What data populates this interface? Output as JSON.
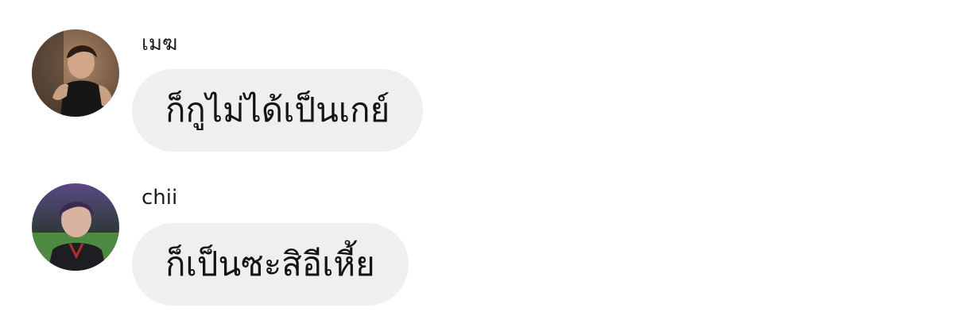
{
  "messages": [
    {
      "sender": "เมฆ",
      "text": "ก็กูไม่ได้เป็นเกย์",
      "avatar_icon": "user-avatar-photo"
    },
    {
      "sender": "chii",
      "text": "ก็เป็นซะสิอีเหี้ย",
      "avatar_icon": "user-avatar-photo"
    }
  ],
  "colors": {
    "background": "#ffffff",
    "bubble": "#efefef",
    "text": "#141414"
  }
}
